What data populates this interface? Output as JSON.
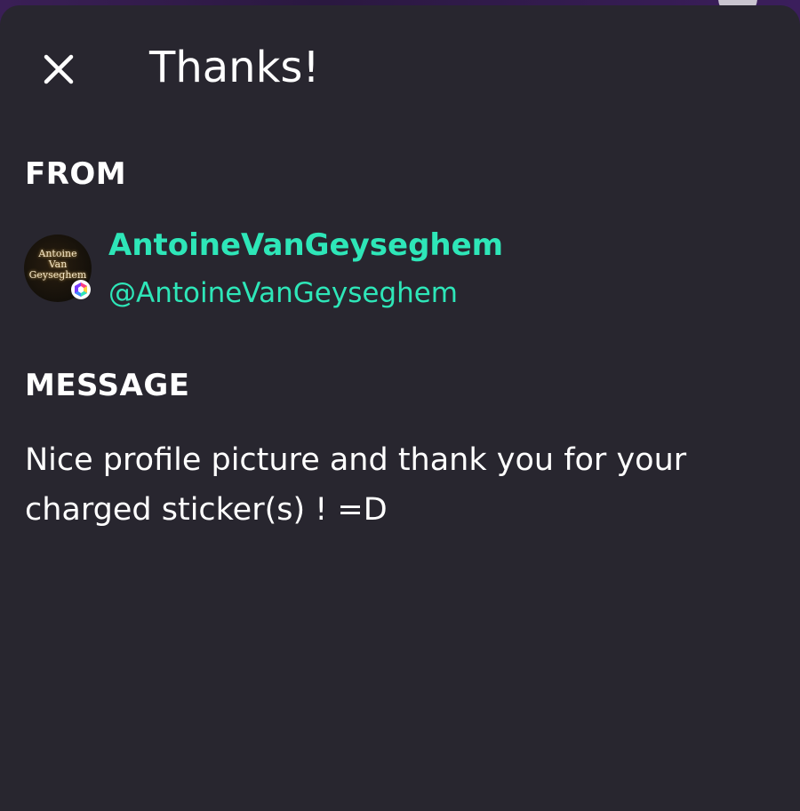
{
  "sheet": {
    "title": "Thanks!",
    "close_icon": "close-icon"
  },
  "from": {
    "label": "FROM",
    "display_name": "AntoineVanGeyseghem",
    "handle": "@AntoineVanGeyseghem",
    "avatar_text": [
      "Antoine",
      "Van",
      "Geyseghem"
    ],
    "badge_icon": "hexagon-badge-icon"
  },
  "message": {
    "label": "MESSAGE",
    "text": "Nice profile picture and thank you for your charged sticker(s) ! =D"
  },
  "colors": {
    "accent": "#2ee6b8",
    "sheet_background": "#28262f",
    "text": "#ffffff"
  }
}
